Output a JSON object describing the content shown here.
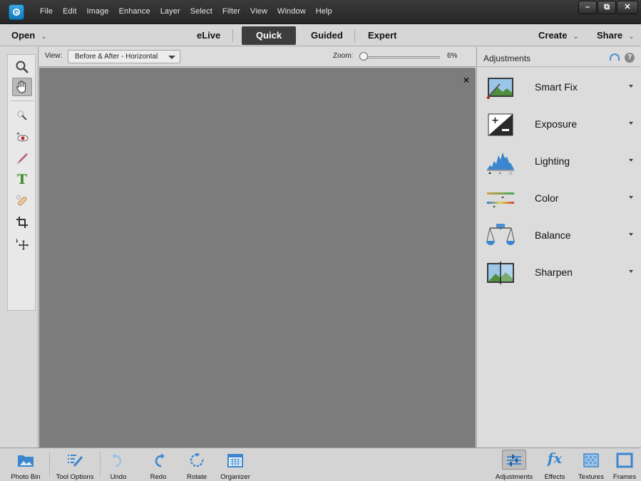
{
  "menu": {
    "items": [
      "File",
      "Edit",
      "Image",
      "Enhance",
      "Layer",
      "Select",
      "Filter",
      "View",
      "Window",
      "Help"
    ]
  },
  "window_controls": {
    "minimize": "–",
    "restore": "⧉",
    "close": "✕"
  },
  "modebar": {
    "open_label": "Open",
    "tabs": {
      "elive": "eLive",
      "quick": "Quick",
      "guided": "Guided",
      "expert": "Expert"
    },
    "create_label": "Create",
    "share_label": "Share"
  },
  "viewbar": {
    "view_label": "View:",
    "view_selected": "Before & After - Horizontal",
    "zoom_label": "Zoom:",
    "zoom_value": "6%",
    "zoom_fraction": 0.06
  },
  "canvas": {
    "close_glyph": "×"
  },
  "panel": {
    "title": "Adjustments",
    "help_glyph": "?",
    "items": [
      {
        "label": "Smart Fix"
      },
      {
        "label": "Exposure"
      },
      {
        "label": "Lighting"
      },
      {
        "label": "Color"
      },
      {
        "label": "Balance"
      },
      {
        "label": "Sharpen"
      }
    ]
  },
  "bottombar": {
    "photo_bin": "Photo Bin",
    "tool_options": "Tool Options",
    "undo": "Undo",
    "redo": "Redo",
    "rotate": "Rotate",
    "organizer": "Organizer",
    "adjustments": "Adjustments",
    "effects": "Effects",
    "textures": "Textures",
    "frames": "Frames"
  },
  "colors": {
    "titlebar": "#2e2e2e",
    "canvas": "#7c7c7c",
    "accent_blue": "#3a8fd0",
    "active_tab": "#3d3d3d"
  }
}
